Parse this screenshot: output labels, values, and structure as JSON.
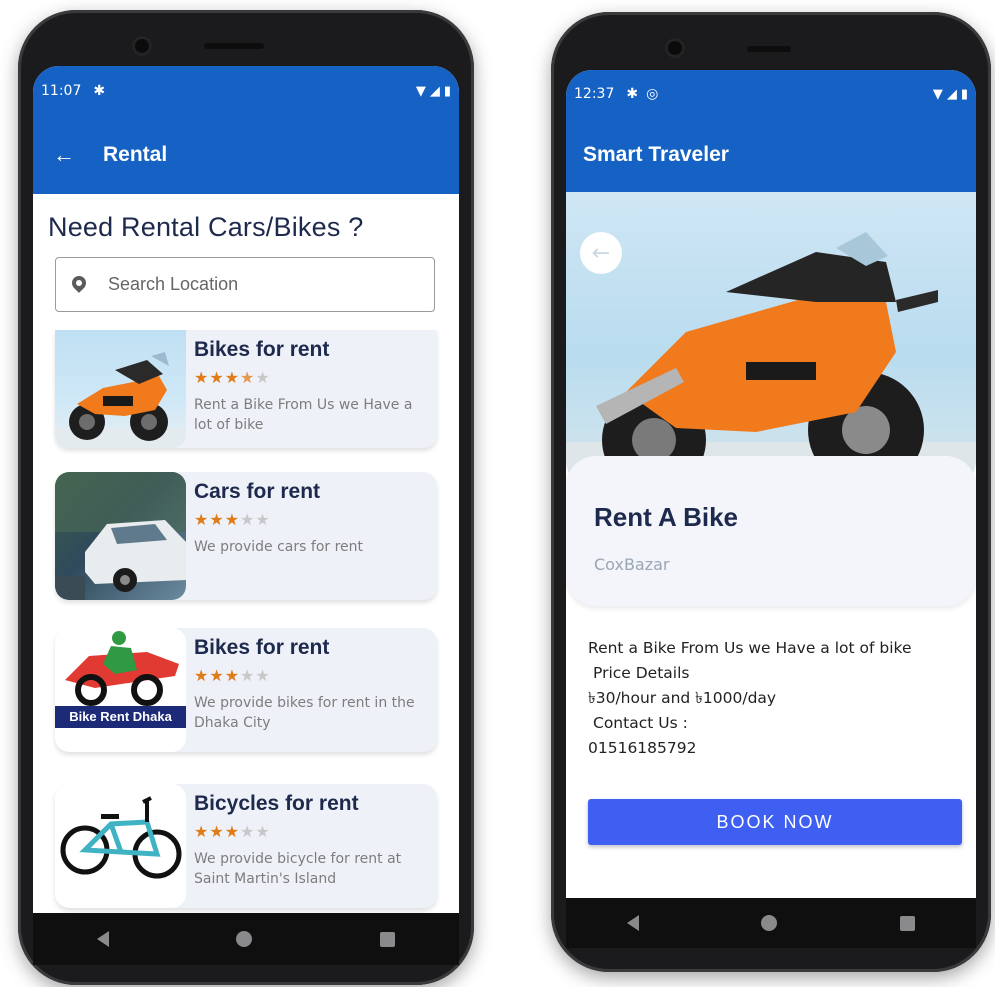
{
  "colors": {
    "primary": "#1662c4",
    "accent_button": "#3f5ff2",
    "star": "#e07b1a",
    "card_bg": "#eef1f7",
    "heading_text": "#1e2a4d"
  },
  "left_phone": {
    "status_time": "11:07",
    "status_icons": [
      "settings-icon",
      "wifi-icon",
      "signal-icon",
      "battery-icon"
    ],
    "toolbar_title": "Rental",
    "heading": "Need Rental Cars/Bikes ?",
    "search": {
      "placeholder": "Search Location",
      "value": ""
    },
    "cards": [
      {
        "title": "Bikes for rent",
        "rating": 3.5,
        "max_rating": 5,
        "description": "Rent a Bike From Us we Have a lot of bike",
        "image": "orange-sport-motorbike"
      },
      {
        "title": "Cars for rent",
        "rating": 3,
        "max_rating": 5,
        "description": "We provide cars for rent",
        "image": "white-sedan-car"
      },
      {
        "title": "Bikes for rent",
        "rating": 3,
        "max_rating": 5,
        "description": "We provide bikes for rent in the Dhaka City",
        "image": "bike-rent-dhaka-logo",
        "logo_text": "Bike Rent Dhaka"
      },
      {
        "title": "Bicycles for rent",
        "rating": 3,
        "max_rating": 5,
        "description": "We provide bicycle for rent at Saint Martin's Island",
        "image": "teal-bicycle"
      }
    ]
  },
  "right_phone": {
    "status_time": "12:37",
    "status_icons": [
      "settings-icon",
      "sync-icon",
      "wifi-icon",
      "signal-icon",
      "battery-icon"
    ],
    "toolbar_title": "Smart Traveler",
    "hero_image": "orange-sport-motorbike",
    "detail": {
      "title": "Rent A Bike",
      "location": "CoxBazar",
      "line1": "Rent a Bike From Us we Have a lot of bike",
      "line2": "Price Details",
      "line3": "৳30/hour and ৳1000/day",
      "line4": "Contact Us :",
      "line5": "01516185792"
    },
    "book_button": "BOOK NOW"
  }
}
